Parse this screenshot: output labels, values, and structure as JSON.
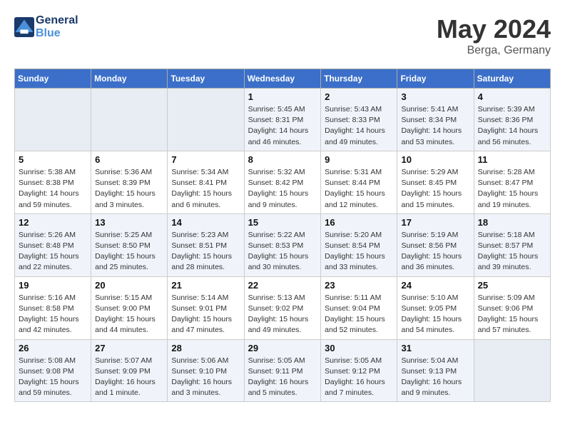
{
  "header": {
    "logo_line1": "General",
    "logo_line2": "Blue",
    "month": "May 2024",
    "location": "Berga, Germany"
  },
  "weekdays": [
    "Sunday",
    "Monday",
    "Tuesday",
    "Wednesday",
    "Thursday",
    "Friday",
    "Saturday"
  ],
  "weeks": [
    [
      {
        "day": "",
        "info": ""
      },
      {
        "day": "",
        "info": ""
      },
      {
        "day": "",
        "info": ""
      },
      {
        "day": "1",
        "info": "Sunrise: 5:45 AM\nSunset: 8:31 PM\nDaylight: 14 hours\nand 46 minutes."
      },
      {
        "day": "2",
        "info": "Sunrise: 5:43 AM\nSunset: 8:33 PM\nDaylight: 14 hours\nand 49 minutes."
      },
      {
        "day": "3",
        "info": "Sunrise: 5:41 AM\nSunset: 8:34 PM\nDaylight: 14 hours\nand 53 minutes."
      },
      {
        "day": "4",
        "info": "Sunrise: 5:39 AM\nSunset: 8:36 PM\nDaylight: 14 hours\nand 56 minutes."
      }
    ],
    [
      {
        "day": "5",
        "info": "Sunrise: 5:38 AM\nSunset: 8:38 PM\nDaylight: 14 hours\nand 59 minutes."
      },
      {
        "day": "6",
        "info": "Sunrise: 5:36 AM\nSunset: 8:39 PM\nDaylight: 15 hours\nand 3 minutes."
      },
      {
        "day": "7",
        "info": "Sunrise: 5:34 AM\nSunset: 8:41 PM\nDaylight: 15 hours\nand 6 minutes."
      },
      {
        "day": "8",
        "info": "Sunrise: 5:32 AM\nSunset: 8:42 PM\nDaylight: 15 hours\nand 9 minutes."
      },
      {
        "day": "9",
        "info": "Sunrise: 5:31 AM\nSunset: 8:44 PM\nDaylight: 15 hours\nand 12 minutes."
      },
      {
        "day": "10",
        "info": "Sunrise: 5:29 AM\nSunset: 8:45 PM\nDaylight: 15 hours\nand 15 minutes."
      },
      {
        "day": "11",
        "info": "Sunrise: 5:28 AM\nSunset: 8:47 PM\nDaylight: 15 hours\nand 19 minutes."
      }
    ],
    [
      {
        "day": "12",
        "info": "Sunrise: 5:26 AM\nSunset: 8:48 PM\nDaylight: 15 hours\nand 22 minutes."
      },
      {
        "day": "13",
        "info": "Sunrise: 5:25 AM\nSunset: 8:50 PM\nDaylight: 15 hours\nand 25 minutes."
      },
      {
        "day": "14",
        "info": "Sunrise: 5:23 AM\nSunset: 8:51 PM\nDaylight: 15 hours\nand 28 minutes."
      },
      {
        "day": "15",
        "info": "Sunrise: 5:22 AM\nSunset: 8:53 PM\nDaylight: 15 hours\nand 30 minutes."
      },
      {
        "day": "16",
        "info": "Sunrise: 5:20 AM\nSunset: 8:54 PM\nDaylight: 15 hours\nand 33 minutes."
      },
      {
        "day": "17",
        "info": "Sunrise: 5:19 AM\nSunset: 8:56 PM\nDaylight: 15 hours\nand 36 minutes."
      },
      {
        "day": "18",
        "info": "Sunrise: 5:18 AM\nSunset: 8:57 PM\nDaylight: 15 hours\nand 39 minutes."
      }
    ],
    [
      {
        "day": "19",
        "info": "Sunrise: 5:16 AM\nSunset: 8:58 PM\nDaylight: 15 hours\nand 42 minutes."
      },
      {
        "day": "20",
        "info": "Sunrise: 5:15 AM\nSunset: 9:00 PM\nDaylight: 15 hours\nand 44 minutes."
      },
      {
        "day": "21",
        "info": "Sunrise: 5:14 AM\nSunset: 9:01 PM\nDaylight: 15 hours\nand 47 minutes."
      },
      {
        "day": "22",
        "info": "Sunrise: 5:13 AM\nSunset: 9:02 PM\nDaylight: 15 hours\nand 49 minutes."
      },
      {
        "day": "23",
        "info": "Sunrise: 5:11 AM\nSunset: 9:04 PM\nDaylight: 15 hours\nand 52 minutes."
      },
      {
        "day": "24",
        "info": "Sunrise: 5:10 AM\nSunset: 9:05 PM\nDaylight: 15 hours\nand 54 minutes."
      },
      {
        "day": "25",
        "info": "Sunrise: 5:09 AM\nSunset: 9:06 PM\nDaylight: 15 hours\nand 57 minutes."
      }
    ],
    [
      {
        "day": "26",
        "info": "Sunrise: 5:08 AM\nSunset: 9:08 PM\nDaylight: 15 hours\nand 59 minutes."
      },
      {
        "day": "27",
        "info": "Sunrise: 5:07 AM\nSunset: 9:09 PM\nDaylight: 16 hours\nand 1 minute."
      },
      {
        "day": "28",
        "info": "Sunrise: 5:06 AM\nSunset: 9:10 PM\nDaylight: 16 hours\nand 3 minutes."
      },
      {
        "day": "29",
        "info": "Sunrise: 5:05 AM\nSunset: 9:11 PM\nDaylight: 16 hours\nand 5 minutes."
      },
      {
        "day": "30",
        "info": "Sunrise: 5:05 AM\nSunset: 9:12 PM\nDaylight: 16 hours\nand 7 minutes."
      },
      {
        "day": "31",
        "info": "Sunrise: 5:04 AM\nSunset: 9:13 PM\nDaylight: 16 hours\nand 9 minutes."
      },
      {
        "day": "",
        "info": ""
      }
    ]
  ]
}
